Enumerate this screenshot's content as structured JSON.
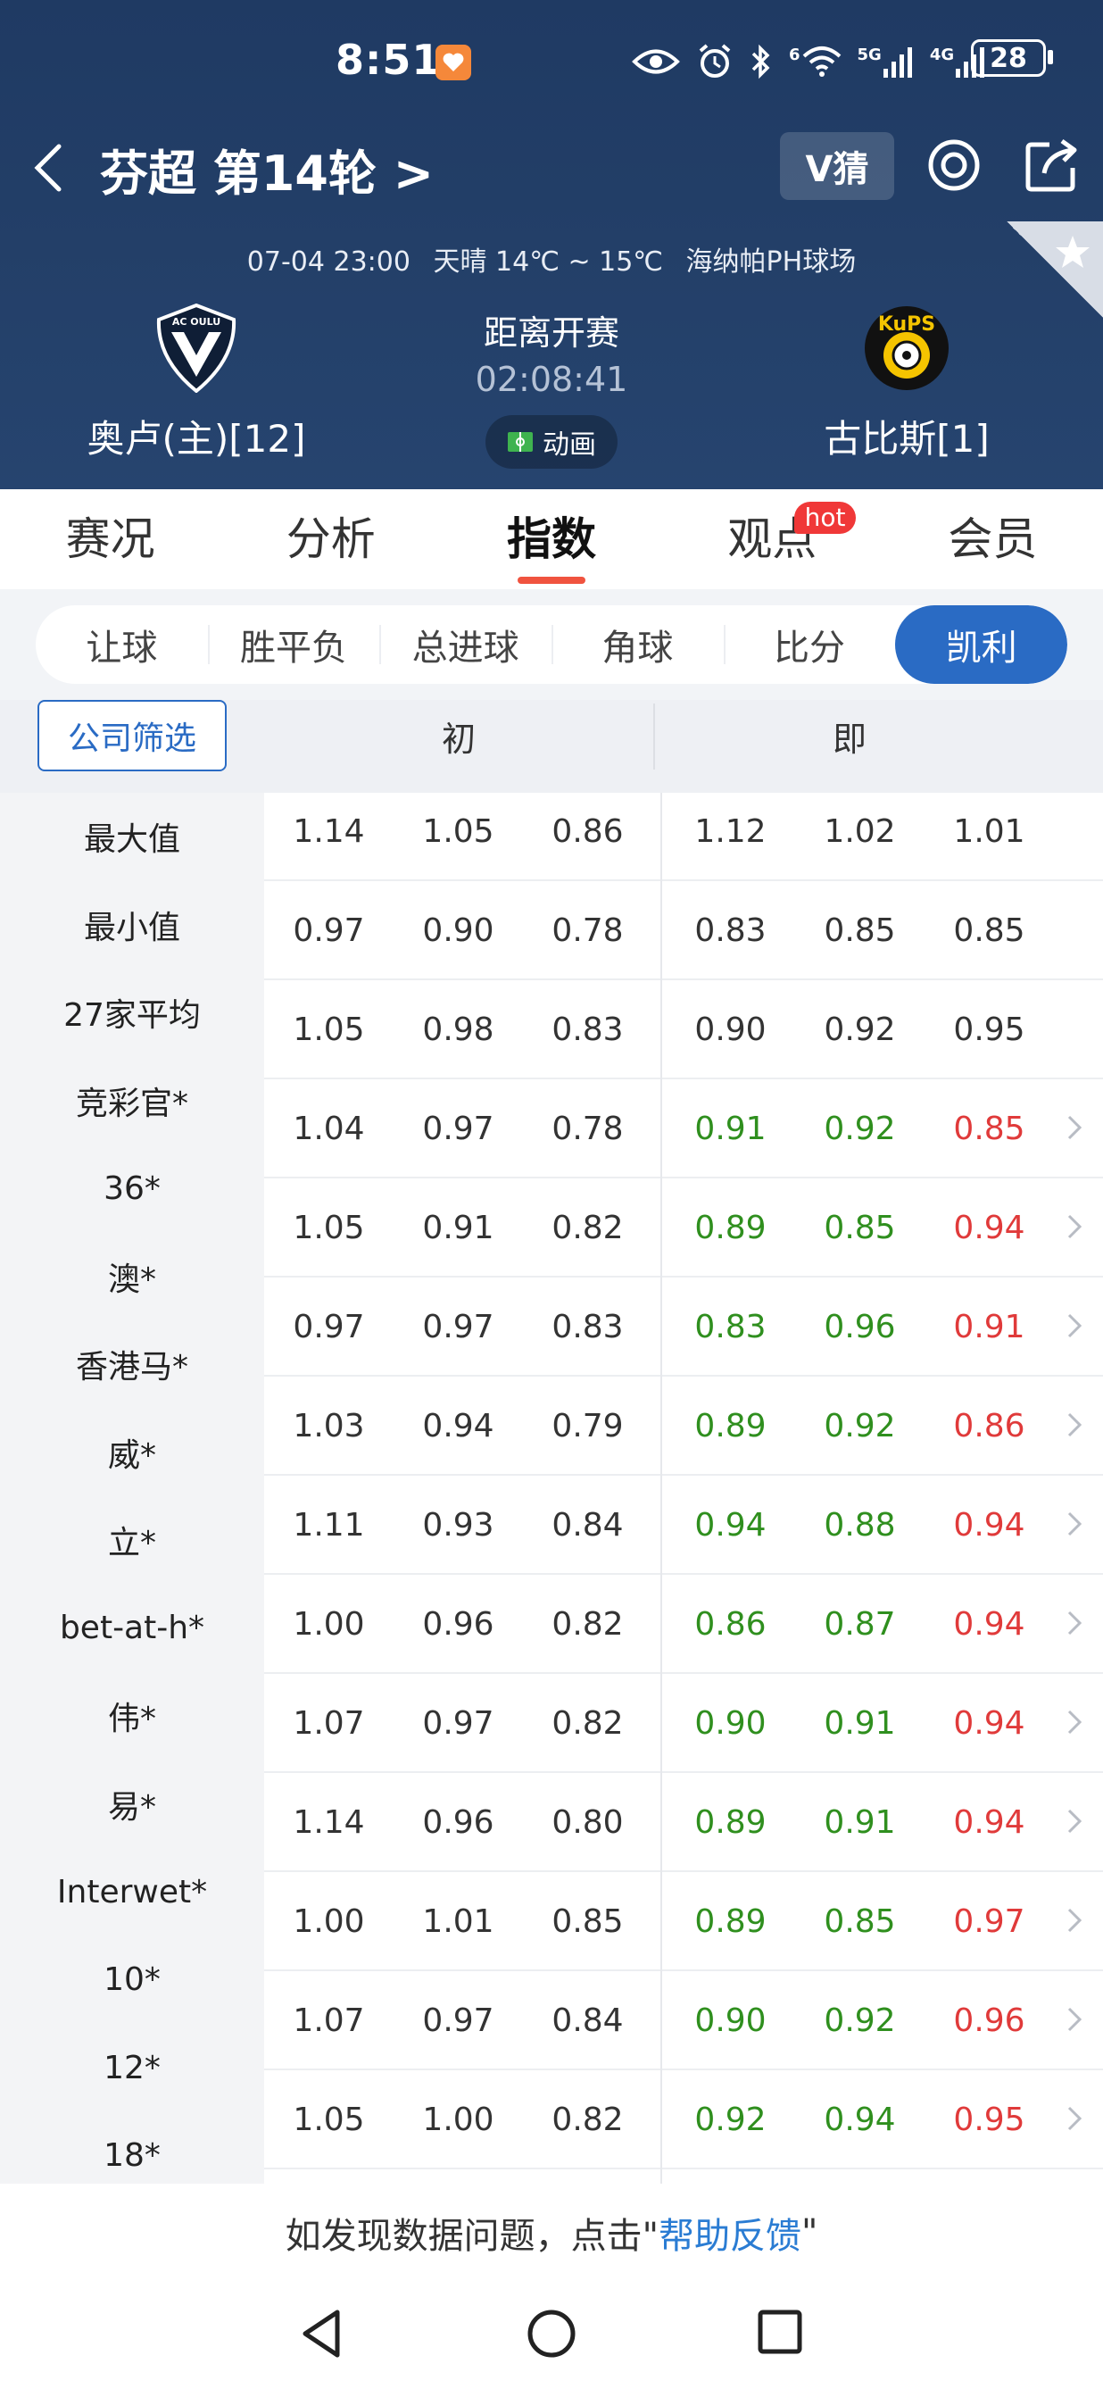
{
  "status": {
    "time": "8:51",
    "battery": "28",
    "net1": "5G",
    "net2": "4G",
    "wifi_sub": "6"
  },
  "header": {
    "title": "芬超 第14轮 >",
    "vguess": "V猜",
    "info": {
      "datetime": "07-04 23:00",
      "weather": "天晴 14℃ ~ 15℃",
      "venue": "海纳帕PH球场"
    },
    "home": {
      "name": "奥卢(主)[12]",
      "logo_text": "AC OULU"
    },
    "away": {
      "name": "古比斯[1]",
      "logo_text": "KuPS"
    },
    "kickoff_label": "距离开赛",
    "countdown": "02:08:41",
    "anim_label": "动画"
  },
  "main_tabs": [
    {
      "label": "赛况"
    },
    {
      "label": "分析"
    },
    {
      "label": "指数"
    },
    {
      "label": "观点"
    },
    {
      "label": "会员"
    }
  ],
  "hot_badge": "hot",
  "sub_tabs": [
    {
      "label": "让球"
    },
    {
      "label": "胜平负"
    },
    {
      "label": "总进球"
    },
    {
      "label": "角球"
    },
    {
      "label": "比分"
    },
    {
      "label": "凯利"
    }
  ],
  "table": {
    "filter_label": "公司筛选",
    "col_initial": "初",
    "col_live": "即",
    "names": [
      "最大值",
      "最小值",
      "27家平均",
      "竞彩官*",
      "36*",
      "澳*",
      "香港马*",
      "威*",
      "立*",
      "bet-at-h*",
      "伟*",
      "易*",
      "Interwet*",
      "10*",
      "12*",
      "18*"
    ],
    "rows": [
      {
        "init": [
          "1.14",
          "1.05",
          "0.86"
        ],
        "live": [
          "1.12",
          "1.02",
          "1.01"
        ],
        "colored": false
      },
      {
        "init": [
          "0.97",
          "0.90",
          "0.78"
        ],
        "live": [
          "0.83",
          "0.85",
          "0.85"
        ],
        "colored": false
      },
      {
        "init": [
          "1.05",
          "0.98",
          "0.83"
        ],
        "live": [
          "0.90",
          "0.92",
          "0.95"
        ],
        "colored": false
      },
      {
        "init": [
          "1.04",
          "0.97",
          "0.78"
        ],
        "live": [
          "0.91",
          "0.92",
          "0.85"
        ],
        "colored": true
      },
      {
        "init": [
          "1.05",
          "0.91",
          "0.82"
        ],
        "live": [
          "0.89",
          "0.85",
          "0.94"
        ],
        "colored": true
      },
      {
        "init": [
          "0.97",
          "0.97",
          "0.83"
        ],
        "live": [
          "0.83",
          "0.96",
          "0.91"
        ],
        "colored": true
      },
      {
        "init": [
          "1.03",
          "0.94",
          "0.79"
        ],
        "live": [
          "0.89",
          "0.92",
          "0.86"
        ],
        "colored": true
      },
      {
        "init": [
          "1.11",
          "0.93",
          "0.84"
        ],
        "live": [
          "0.94",
          "0.88",
          "0.94"
        ],
        "colored": true
      },
      {
        "init": [
          "1.00",
          "0.96",
          "0.82"
        ],
        "live": [
          "0.86",
          "0.87",
          "0.94"
        ],
        "colored": true
      },
      {
        "init": [
          "1.07",
          "0.97",
          "0.82"
        ],
        "live": [
          "0.90",
          "0.91",
          "0.94"
        ],
        "colored": true
      },
      {
        "init": [
          "1.14",
          "0.96",
          "0.80"
        ],
        "live": [
          "0.89",
          "0.91",
          "0.94"
        ],
        "colored": true
      },
      {
        "init": [
          "1.00",
          "1.01",
          "0.85"
        ],
        "live": [
          "0.89",
          "0.85",
          "0.97"
        ],
        "colored": true
      },
      {
        "init": [
          "1.07",
          "0.97",
          "0.84"
        ],
        "live": [
          "0.90",
          "0.92",
          "0.96"
        ],
        "colored": true
      },
      {
        "init": [
          "1.05",
          "1.00",
          "0.82"
        ],
        "live": [
          "0.92",
          "0.94",
          "0.95"
        ],
        "colored": true
      }
    ]
  },
  "feedback": {
    "prefix": "如发现数据问题，点击\"",
    "link": "帮助反馈",
    "suffix": "\""
  },
  "colors": {
    "header_bg": "#233f68",
    "accent_blue": "#2a6bc4",
    "green": "#2f8f1e",
    "red": "#e03a3a",
    "tab_indicator": "#f0533f"
  }
}
